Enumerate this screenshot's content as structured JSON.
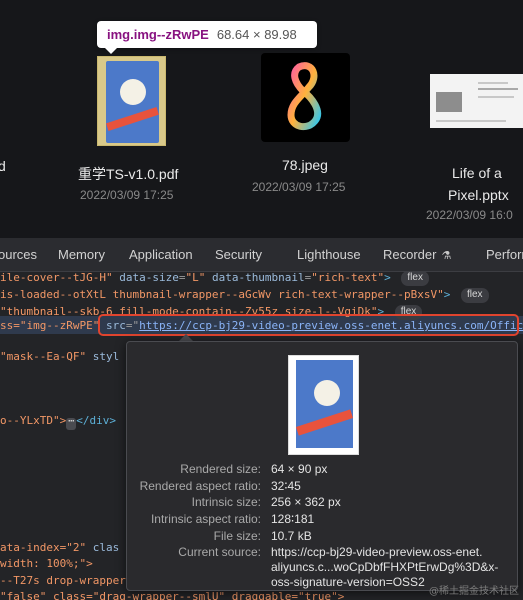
{
  "files": {
    "hover_tooltip": {
      "selector": "img.img--zRwPE",
      "dimensions": "68.64 × 89.98"
    },
    "left_edge_fragment": "d",
    "items": [
      {
        "name": "重学TS-v1.0.pdf",
        "date": "2022/03/09 17:25",
        "icon": "pdf-thumbnail"
      },
      {
        "name": "78.jpeg",
        "date": "2022/03/09 17:25",
        "icon": "image-thumbnail-8-logo"
      },
      {
        "name_line1": "Life of a",
        "name_line2": "Pixel.pptx",
        "date": "2022/03/09 16:0",
        "icon": "pptx-thumbnail"
      }
    ]
  },
  "devtools": {
    "tabs": [
      "ources",
      "Memory",
      "Application",
      "Security",
      "Lighthouse",
      "Recorder",
      "Perform"
    ],
    "recorder_icon": "flask-icon",
    "lines": {
      "l1": {
        "a": "ile-cover--tJG-H\"",
        "b": "data-size",
        "c": "\"L\"",
        "d": "data-thumbnail",
        "e": "\"rich-text\"",
        "badge": "flex"
      },
      "l2": {
        "a": "is-loaded--otXtL thumbnail-wrapper--aGcWv rich-text-wrapper--pBxsV\"",
        "badge": "flex"
      },
      "l3": {
        "a": "\"thumbnail--skb-6 fill-mode-contain--Zv55z size-l--VgiDk\"",
        "badge": "flex"
      },
      "l4": {
        "a": "ss=\"img--zRwPE\"",
        "b": "src",
        "c": "https://ccp-bj29-video-preview.oss-enet.aliyuncs.com/Offic"
      },
      "l5": {
        "a": "\"mask--Ea-QF\"",
        "b": "styl"
      },
      "l6": {
        "a": "o--YLxTD\">",
        "dots": "⋯",
        "b": "</div>"
      },
      "l7": {
        "a": "ata-index=\"2\"",
        "b": "clas"
      },
      "l8": {
        "a": " width: 100%;\">"
      },
      "l9": {
        "a": "--T27s drop-wrapper"
      },
      "l10": {
        "a": "\"false\" class=\"drag-wrapper--smlU\" draggable=\"true\">"
      }
    }
  },
  "preview": {
    "rows": [
      {
        "label": "Rendered size:",
        "value": "64 × 90 px"
      },
      {
        "label": "Rendered aspect ratio:",
        "value": "32∶45"
      },
      {
        "label": "Intrinsic size:",
        "value": "256 × 362 px"
      },
      {
        "label": "Intrinsic aspect ratio:",
        "value": "128∶181"
      },
      {
        "label": "File size:",
        "value": "10.7 kB"
      },
      {
        "label": "Current source:",
        "value_line1": "https://ccp-bj29-video-preview.oss-enet.",
        "value_line2": "aliyuncs.c...woCpDbfFHXPtErwDg%3D&x-",
        "value_line3": "oss-signature-version=OSS2"
      }
    ]
  },
  "watermark": "@稀土掘金技术社区"
}
